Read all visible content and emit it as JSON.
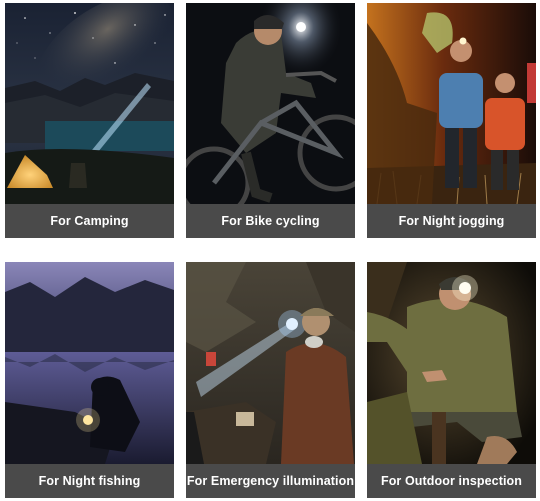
{
  "tiles": [
    {
      "caption": "For  Camping",
      "scene": "starry-night-camp-photo"
    },
    {
      "caption": "For  Bike cycling",
      "scene": "bike-cyclist-photo"
    },
    {
      "caption": "For  Night jogging",
      "scene": "night-joggers-photo"
    },
    {
      "caption": "For Night fishing",
      "scene": "lake-fishing-photo"
    },
    {
      "caption": "For Emergency illumination",
      "scene": "quarry-worker-photo"
    },
    {
      "caption": "For  Outdoor inspection",
      "scene": "cave-inspection-photo"
    }
  ]
}
